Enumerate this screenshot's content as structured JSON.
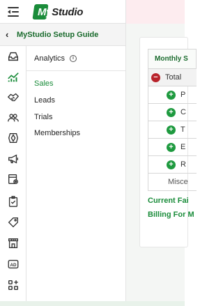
{
  "header": {
    "logo_text_first": "My",
    "logo_text_rest": "Studio"
  },
  "setup_guide": {
    "label": "MyStudio Setup Guide"
  },
  "rail_icons": [
    "inbox-icon",
    "analytics-icon",
    "handshake-icon",
    "members-icon",
    "programs-icon",
    "megaphone-icon",
    "settings-page-icon",
    "checklist-icon",
    "tag-icon",
    "store-icon",
    "ad-icon",
    "apps-icon"
  ],
  "submenu": {
    "title": "Analytics",
    "info_glyph": "i",
    "items": [
      {
        "label": "Sales",
        "active": true
      },
      {
        "label": "Leads",
        "active": false
      },
      {
        "label": "Trials",
        "active": false
      },
      {
        "label": "Memberships",
        "active": false
      }
    ]
  },
  "main": {
    "table_header": "Monthly S",
    "total_label": "Total",
    "sub_rows": [
      "P",
      "C",
      "T",
      "E",
      "R"
    ],
    "misc_label": "Misce",
    "links": [
      "Current Fai",
      "Billing For M"
    ]
  },
  "colors": {
    "brand_green": "#1a8c3a",
    "minus_red": "#b8232b",
    "plus_green": "#1e9a3f",
    "topbar_pink": "#fdecef"
  }
}
